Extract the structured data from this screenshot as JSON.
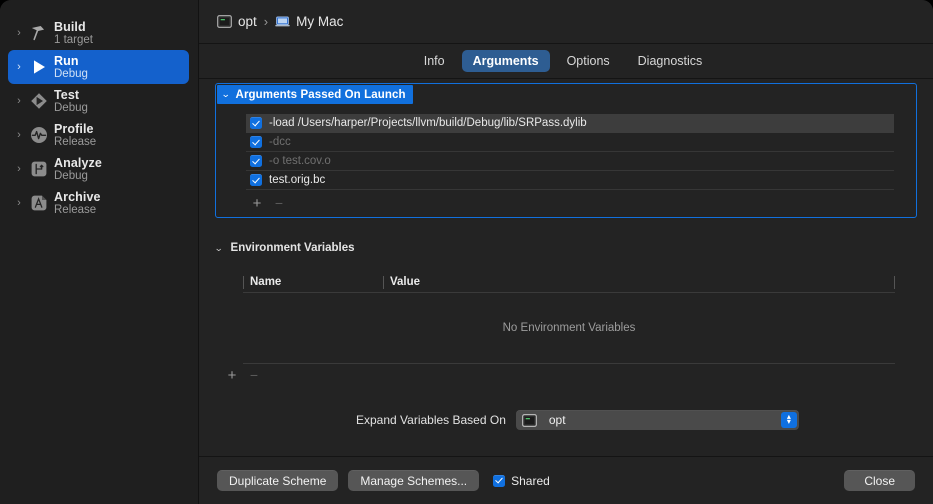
{
  "window": {
    "breadcrumb": {
      "scheme_name": "opt",
      "scheme_icon": "terminal-target-icon",
      "separator": "›",
      "destination_name": "My Mac",
      "destination_icon": "laptop-icon"
    }
  },
  "sidebar": {
    "items": [
      {
        "title": "Build",
        "subtitle": "1 target",
        "icon": "hammer-icon",
        "selected": false
      },
      {
        "title": "Run",
        "subtitle": "Debug",
        "icon": "play-icon",
        "selected": true
      },
      {
        "title": "Test",
        "subtitle": "Debug",
        "icon": "test-diamond-icon",
        "selected": false
      },
      {
        "title": "Profile",
        "subtitle": "Release",
        "icon": "profile-waveform-icon",
        "selected": false
      },
      {
        "title": "Analyze",
        "subtitle": "Debug",
        "icon": "analyze-branch-icon",
        "selected": false
      },
      {
        "title": "Archive",
        "subtitle": "Release",
        "icon": "archive-box-icon",
        "selected": false
      }
    ],
    "disclosure_glyph": "›"
  },
  "tabs": [
    {
      "label": "Info",
      "active": false
    },
    {
      "label": "Arguments",
      "active": true
    },
    {
      "label": "Options",
      "active": false
    },
    {
      "label": "Diagnostics",
      "active": false
    }
  ],
  "arguments_section": {
    "title": "Arguments Passed On Launch",
    "twisty": "⌄",
    "rows": [
      {
        "value": "-load /Users/harper/Projects/llvm/build/Debug/lib/SRPass.dylib",
        "checked": true,
        "dimmed": false,
        "highlighted": true
      },
      {
        "value": "-dcc",
        "checked": true,
        "dimmed": true,
        "highlighted": false
      },
      {
        "value": "-o test.cov.o",
        "checked": true,
        "dimmed": true,
        "highlighted": false
      },
      {
        "value": "test.orig.bc",
        "checked": true,
        "dimmed": false,
        "highlighted": false
      }
    ],
    "add_label": "+",
    "remove_label": "−"
  },
  "environment_section": {
    "title": "Environment Variables",
    "twisty": "⌄",
    "columns": {
      "name": "Name",
      "value": "Value"
    },
    "empty_message": "No Environment Variables",
    "rows": [],
    "add_label": "+",
    "remove_label": "−"
  },
  "expand_variables": {
    "label": "Expand Variables Based On",
    "selected": "opt",
    "icon": "terminal-target-icon",
    "up_glyph": "▴",
    "down_glyph": "▾"
  },
  "bottom_bar": {
    "duplicate_scheme": "Duplicate Scheme",
    "manage_schemes": "Manage Schemes...",
    "shared_label": "Shared",
    "shared_checked": true,
    "close": "Close"
  },
  "colors": {
    "accent_blue": "#1170dd",
    "selection_blue": "#1461cc",
    "tab_active": "#2e5d92",
    "checkbox_blue": "#1070e0",
    "window_bg": "#232323",
    "sidebar_bg": "#1f1f1f"
  }
}
